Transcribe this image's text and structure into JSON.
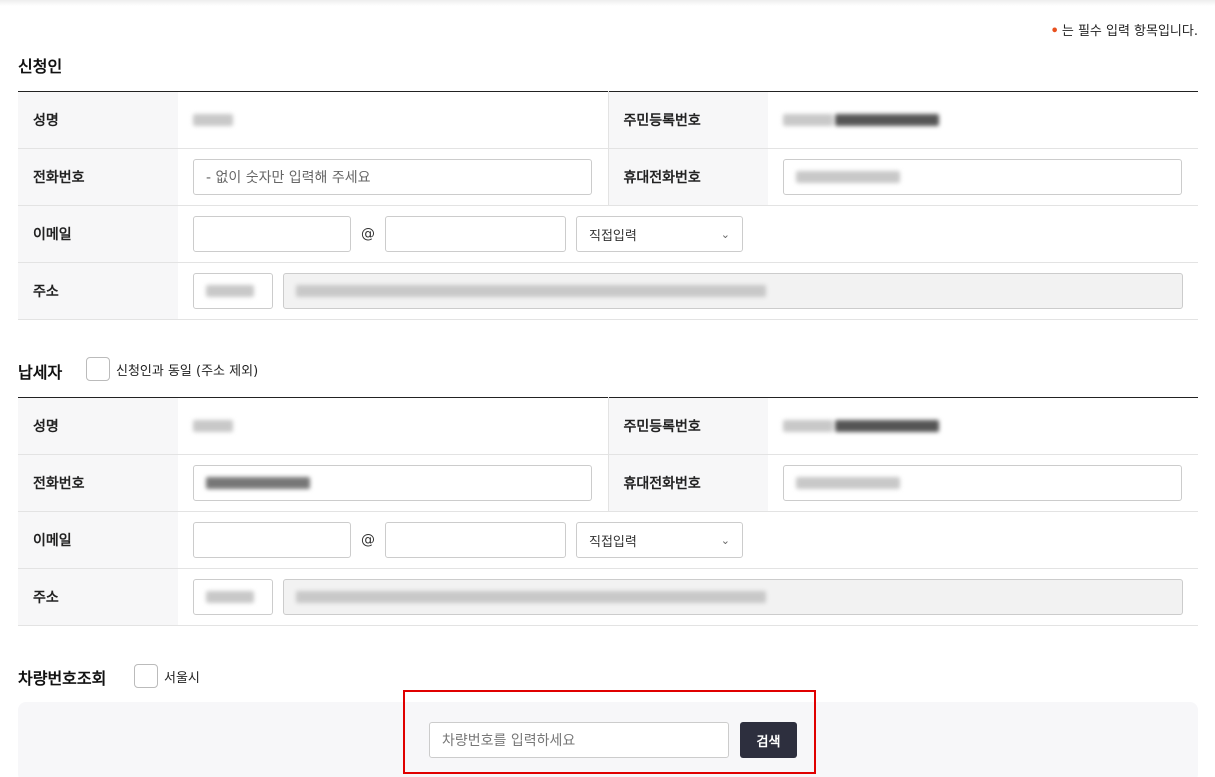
{
  "required_note": {
    "mark": "•",
    "text": "는 필수 입력 항목입니다."
  },
  "applicant": {
    "title": "신청인",
    "name_label": "성명",
    "rrn_label": "주민등록번호",
    "phone_label": "전화번호",
    "phone_placeholder": "- 없이 숫자만 입력해 주세요",
    "mobile_label": "휴대전화번호",
    "email_label": "이메일",
    "email_at": "@",
    "email_domain_select": "직접입력",
    "address_label": "주소"
  },
  "taxpayer": {
    "title": "납세자",
    "same_as_applicant": "신청인과 동일 (주소 제외)",
    "name_label": "성명",
    "rrn_label": "주민등록번호",
    "phone_label": "전화번호",
    "mobile_label": "휴대전화번호",
    "email_label": "이메일",
    "email_at": "@",
    "email_domain_select": "직접입력",
    "address_label": "주소"
  },
  "vehicle": {
    "title": "차량번호조회",
    "seoul_label": "서울시",
    "input_placeholder": "차량번호를 입력하세요",
    "search_button": "검색"
  },
  "colors": {
    "accent_dark": "#2d2f3e",
    "required_dot": "#e8501e",
    "highlight_box": "#e00000"
  },
  "icons": {
    "select_arrow": "chevron-down-icon"
  }
}
